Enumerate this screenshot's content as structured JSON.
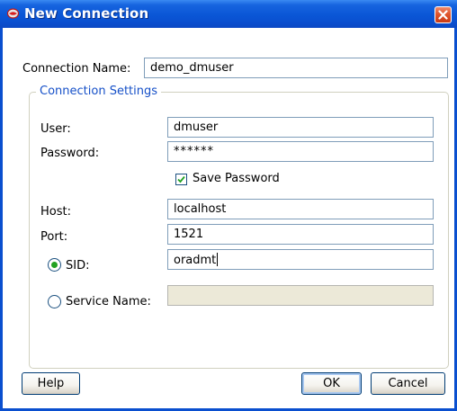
{
  "window": {
    "title": "New Connection",
    "colors": {
      "titlebar": "#0a56d6",
      "close": "#e0552c",
      "body": "#ffffff",
      "legend": "#1650c8"
    }
  },
  "form": {
    "connection_name_label": "Connection Name:",
    "connection_name_value": "demo_dmuser",
    "settings_legend": "Connection Settings",
    "user_label": "User:",
    "user_value": "dmuser",
    "password_label": "Password:",
    "password_value": "******",
    "save_password_label": "Save Password",
    "save_password_checked": true,
    "host_label": "Host:",
    "host_value": "localhost",
    "port_label": "Port:",
    "port_value": "1521",
    "sid_label": "SID:",
    "sid_value": "oradmt",
    "sid_selected": true,
    "service_name_label": "Service Name:",
    "service_name_value": ""
  },
  "buttons": {
    "help": "Help",
    "ok": "OK",
    "cancel": "Cancel"
  }
}
